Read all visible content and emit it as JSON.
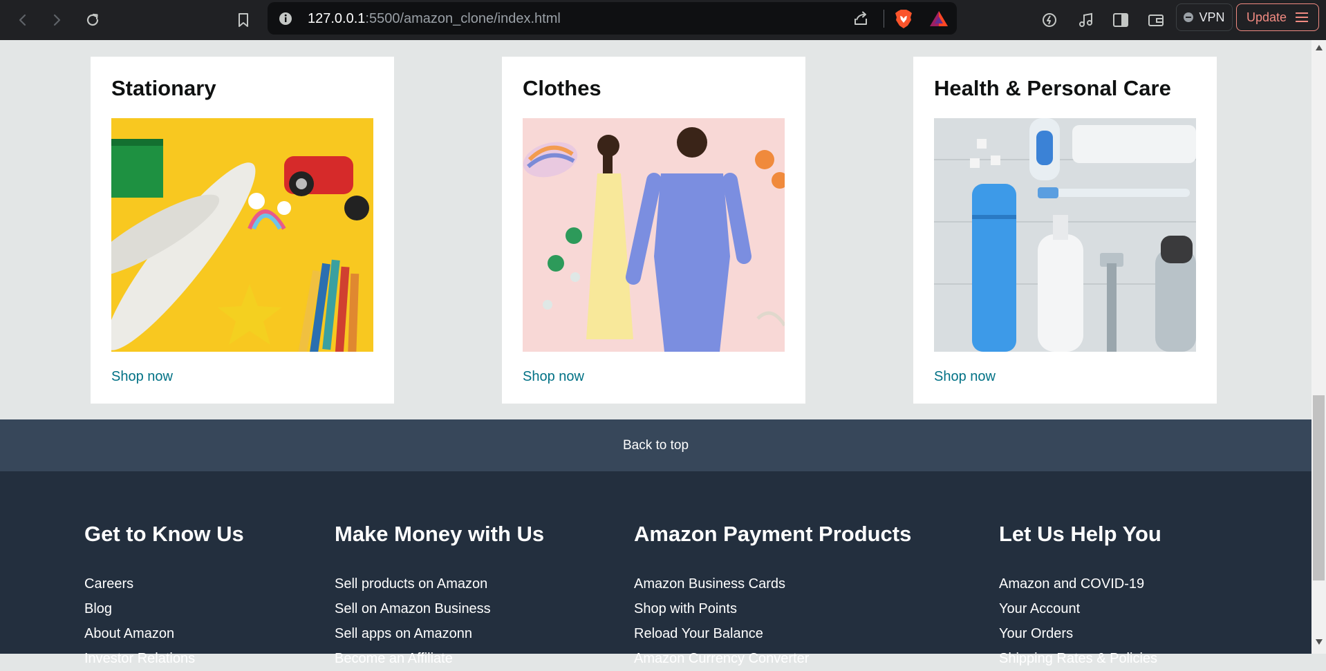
{
  "browser": {
    "url_host": "127.0.0.1",
    "url_path": ":5500/amazon_clone/index.html",
    "vpn_label": "VPN",
    "update_label": "Update",
    "icons": [
      "back-icon",
      "forward-icon",
      "reload-icon",
      "bookmark-icon",
      "site-info-icon",
      "share-icon",
      "brave-shields-icon",
      "brave-rewards-icon",
      "leo-icon",
      "music-icon",
      "sidebar-icon",
      "wallet-icon",
      "menu-icon"
    ]
  },
  "cards": [
    {
      "title": "Stationary",
      "link": "Shop now"
    },
    {
      "title": "Clothes",
      "link": "Shop now"
    },
    {
      "title": "Health & Personal Care",
      "link": "Shop now"
    }
  ],
  "back_to_top": "Back to top",
  "footer": {
    "columns": [
      {
        "title": "Get to Know Us",
        "links": [
          "Careers",
          "Blog",
          "About Amazon",
          "Investor Relations"
        ]
      },
      {
        "title": "Make Money with Us",
        "links": [
          "Sell products on Amazon",
          "Sell on Amazon Business",
          "Sell apps on Amazonn",
          "Become an Affiliate"
        ]
      },
      {
        "title": "Amazon Payment Products",
        "links": [
          "Amazon Business Cards",
          "Shop with Points",
          "Reload Your Balance",
          "Amazon Currency Converter"
        ]
      },
      {
        "title": "Let Us Help You",
        "links": [
          "Amazon and COVID-19",
          "Your Account",
          "Your Orders",
          "Shipping Rates & Policies"
        ]
      }
    ]
  },
  "colors": {
    "page_bg": "#e3e6e6",
    "link": "#007185",
    "back_to_top_bg": "#37475a",
    "footer_bg": "#232f3e",
    "update_accent": "#f28b82"
  }
}
